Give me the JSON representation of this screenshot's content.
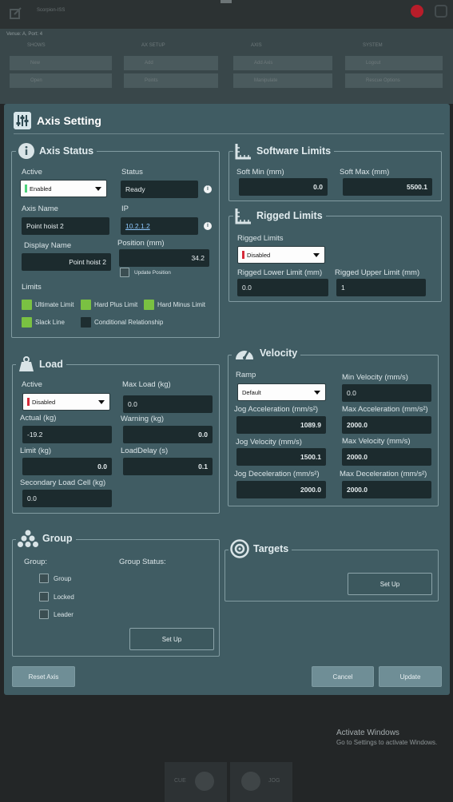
{
  "background": {
    "app_title": "Scorpion-ISS",
    "sub_title": "Venue: A, Port: 4",
    "columns": [
      {
        "header": "SHOWS",
        "items": [
          "New",
          "Open"
        ]
      },
      {
        "header": "AX SETUP",
        "items": [
          "Add",
          "Points"
        ]
      },
      {
        "header": "AXIS",
        "items": [
          "Add Axis",
          "Manipulate"
        ]
      },
      {
        "header": "SYSTEM",
        "items": [
          "Logout",
          "Rescue Options"
        ]
      }
    ],
    "bottom_left": "CUE",
    "bottom_right": "JOG"
  },
  "activate_windows": {
    "title": "Activate Windows",
    "subtitle": "Go to Settings to activate Windows."
  },
  "dialog": {
    "title": "Axis Setting"
  },
  "axis_status": {
    "title": "Axis Status",
    "active_label": "Active",
    "active_value": "Enabled",
    "status_label": "Status",
    "status_value": "Ready",
    "axis_name_label": "Axis Name",
    "axis_name_value": "Point hoist 2",
    "ip_label": "IP",
    "ip_value": "10.2.1.2",
    "display_name_label": "Display Name",
    "display_name_value": "Point hoist 2",
    "position_label": "Position (mm)",
    "position_value": "34.2",
    "update_position_label": "Update Position",
    "limits_label": "Limits",
    "limits": [
      {
        "label": "Ultimate Limit",
        "color": "#7ac142"
      },
      {
        "label": "Hard Plus Limit",
        "color": "#7ac142"
      },
      {
        "label": "Hard Minus Limit",
        "color": "#7ac142"
      },
      {
        "label": "Slack Line",
        "color": "#7ac142"
      },
      {
        "label": "Conditional Relationship",
        "color": "#1e2e31"
      }
    ]
  },
  "software_limits": {
    "title": "Software Limits",
    "soft_min_label": "Soft Min (mm)",
    "soft_min_value": "0.0",
    "soft_max_label": "Soft Max (mm)",
    "soft_max_value": "5500.1"
  },
  "rigged_limits": {
    "title": "Rigged Limits",
    "rigged_limits_label": "Rigged Limits",
    "rigged_limits_value": "Disabled",
    "lower_label": "Rigged Lower Limit (mm)",
    "lower_value": "0.0",
    "upper_label": "Rigged Upper Limit (mm)",
    "upper_value": "1"
  },
  "load": {
    "title": "Load",
    "active_label": "Active",
    "active_value": "Disabled",
    "max_load_label": "Max Load (kg)",
    "max_load_value": "0.0",
    "actual_label": "Actual (kg)",
    "actual_value": "-19.2",
    "warning_label": "Warning (kg)",
    "warning_value": "0.0",
    "limit_label": "Limit (kg)",
    "limit_value": "0.0",
    "load_delay_label": "LoadDelay (s)",
    "load_delay_value": "0.1",
    "secondary_label": "Secondary Load Cell (kg)",
    "secondary_value": "0.0"
  },
  "velocity": {
    "title": "Velocity",
    "ramp_label": "Ramp",
    "ramp_value": "Default",
    "min_velocity_label": "Min Velocity (mm/s)",
    "min_velocity_value": "0.0",
    "jog_accel_label": "Jog Acceleration (mm/s²)",
    "jog_accel_value": "1089.9",
    "max_accel_label": "Max Acceleration (mm/s²)",
    "max_accel_value": "2000.0",
    "jog_velocity_label": "Jog Velocity (mm/s)",
    "jog_velocity_value": "1500.1",
    "max_velocity_label": "Max Velocity (mm/s)",
    "max_velocity_value": "2000.0",
    "jog_decel_label": "Jog Deceleration (mm/s²)",
    "jog_decel_value": "2000.0",
    "max_decel_label": "Max Deceleration (mm/s²)",
    "max_decel_value": "2000.0"
  },
  "group": {
    "title": "Group",
    "group_label": "Group:",
    "status_label": "Group Status:",
    "options": [
      "Group",
      "Locked",
      "Leader"
    ],
    "setup_label": "Set Up"
  },
  "targets": {
    "title": "Targets",
    "setup_label": "Set Up"
  },
  "footer": {
    "reset_label": "Reset Axis",
    "cancel_label": "Cancel",
    "update_label": "Update"
  },
  "colors": {
    "enabled": "#4cd17a",
    "disabled": "#d62b3a",
    "panel": "#405c63",
    "field": "#1c2b2e"
  }
}
